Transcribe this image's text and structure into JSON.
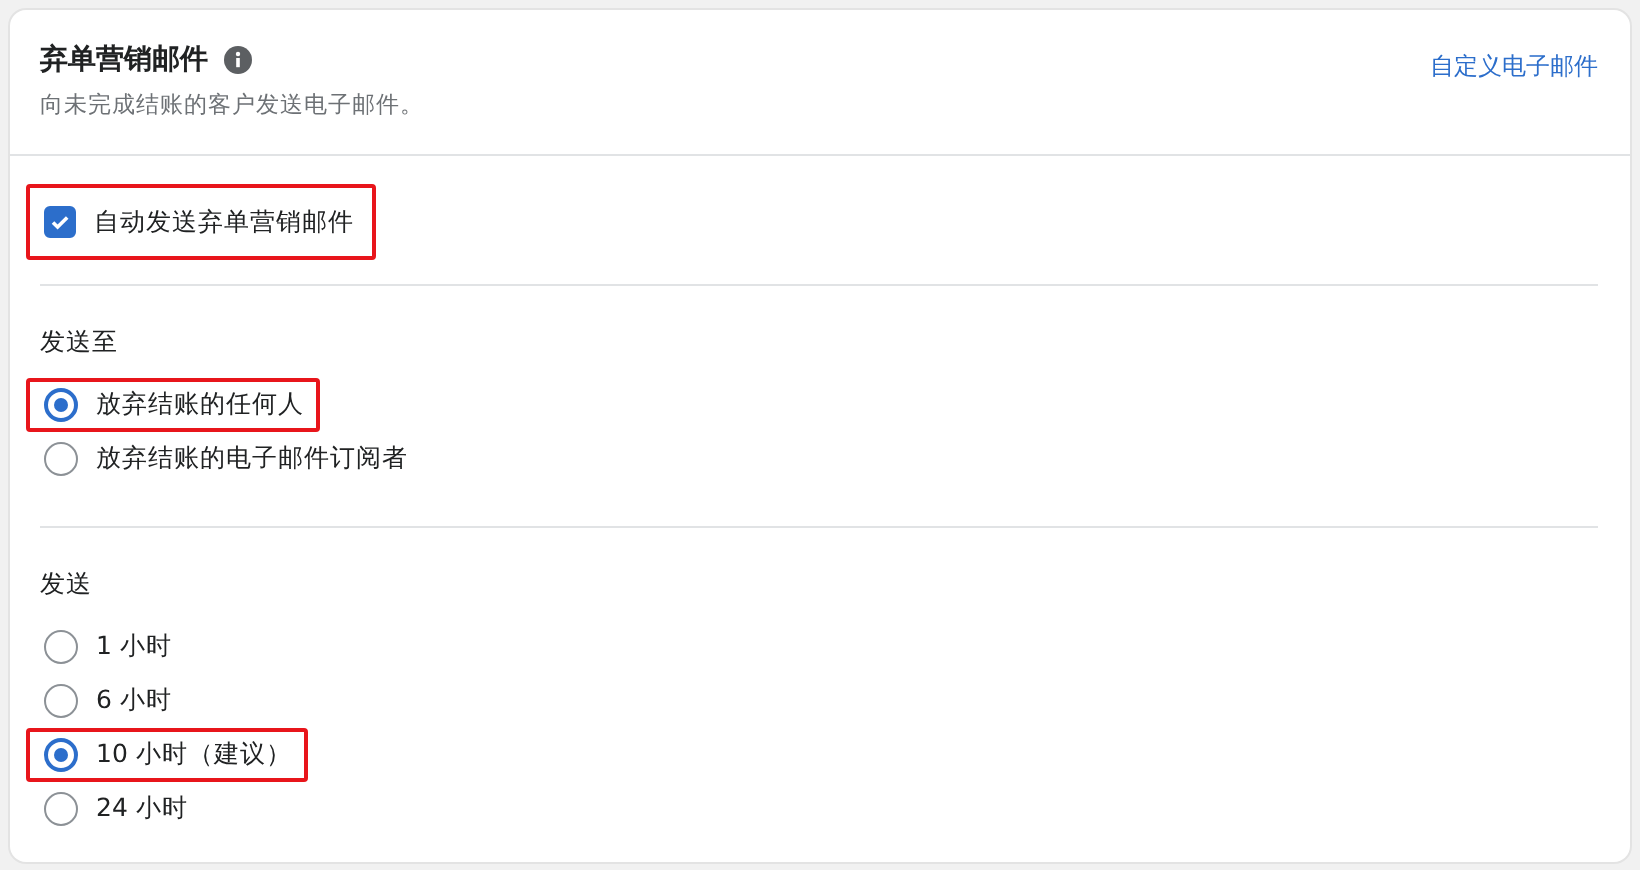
{
  "header": {
    "title": "弃单营销邮件",
    "subtitle": "向未完成结账的客户发送电子邮件。",
    "link": "自定义电子邮件"
  },
  "auto_send": {
    "label": "自动发送弃单营销邮件",
    "checked": true,
    "highlighted": true
  },
  "groups": [
    {
      "title": "发送至",
      "options": [
        {
          "label": "放弃结账的任何人",
          "selected": true,
          "highlighted": true
        },
        {
          "label": "放弃结账的电子邮件订阅者",
          "selected": false,
          "highlighted": false
        }
      ]
    },
    {
      "title": "发送",
      "options": [
        {
          "label": "1 小时",
          "selected": false,
          "highlighted": false
        },
        {
          "label": "6 小时",
          "selected": false,
          "highlighted": false
        },
        {
          "label": "10 小时（建议）",
          "selected": true,
          "highlighted": true
        },
        {
          "label": "24 小时",
          "selected": false,
          "highlighted": false
        }
      ]
    }
  ]
}
